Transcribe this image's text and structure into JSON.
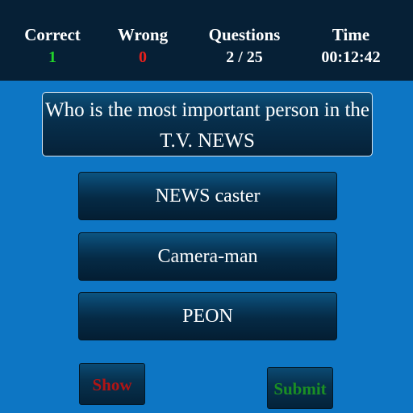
{
  "stats": {
    "correct": {
      "label": "Correct",
      "value": "1",
      "color": "#22d42a"
    },
    "wrong": {
      "label": "Wrong",
      "value": "0",
      "color": "#e8201c"
    },
    "questions": {
      "label": "Questions",
      "value": "2 / 25",
      "color": "#ffffff"
    },
    "time": {
      "label": "Time",
      "value": "00:12:42",
      "color": "#ffffff"
    }
  },
  "question": {
    "text": "Who is the most important person in the T.V. NEWS"
  },
  "answers": [
    {
      "label": "NEWS caster"
    },
    {
      "label": "Camera-man"
    },
    {
      "label": "PEON"
    }
  ],
  "actions": {
    "show_label": "Show",
    "submit_label": "Submit"
  },
  "colors": {
    "background": "#0d76c4",
    "topbar": "#062036",
    "show_text": "#b01515",
    "submit_text": "#1b8f24"
  }
}
